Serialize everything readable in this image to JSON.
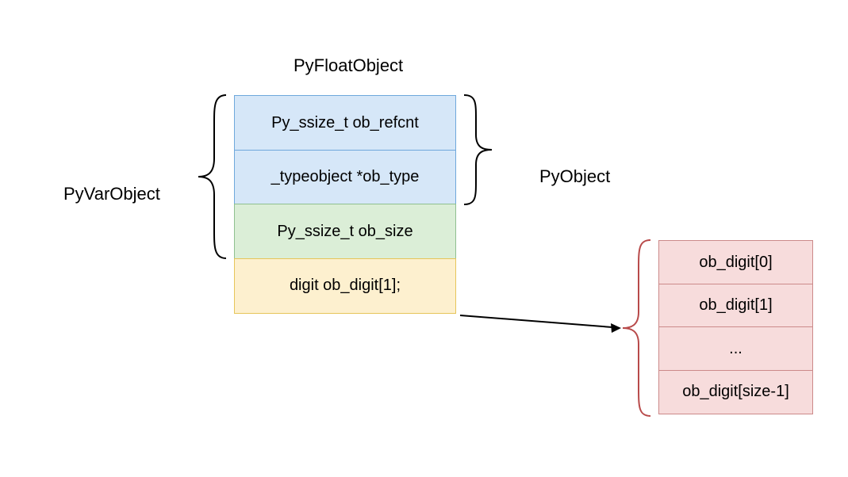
{
  "title": "PyFloatObject",
  "left_label": "PyVarObject",
  "right_label": "PyObject",
  "struct_cells": [
    {
      "text": "Py_ssize_t ob_refcnt",
      "class": "blue"
    },
    {
      "text": "_typeobject *ob_type",
      "class": "blue"
    },
    {
      "text": "Py_ssize_t ob_size",
      "class": "green"
    },
    {
      "text": "digit ob_digit[1];",
      "class": "yellow"
    }
  ],
  "digit_cells": [
    "ob_digit[0]",
    "ob_digit[1]",
    "...",
    "ob_digit[size-1]"
  ],
  "colors": {
    "blue_fill": "#d6e7f8",
    "blue_border": "#6fa8dc",
    "green_fill": "#dbeed7",
    "green_border": "#8fc08f",
    "yellow_fill": "#fdf0cf",
    "yellow_border": "#e6c55a",
    "pink_fill": "#f7dcdc",
    "pink_border": "#cc8a8a",
    "brace_red": "#b84a4a"
  }
}
